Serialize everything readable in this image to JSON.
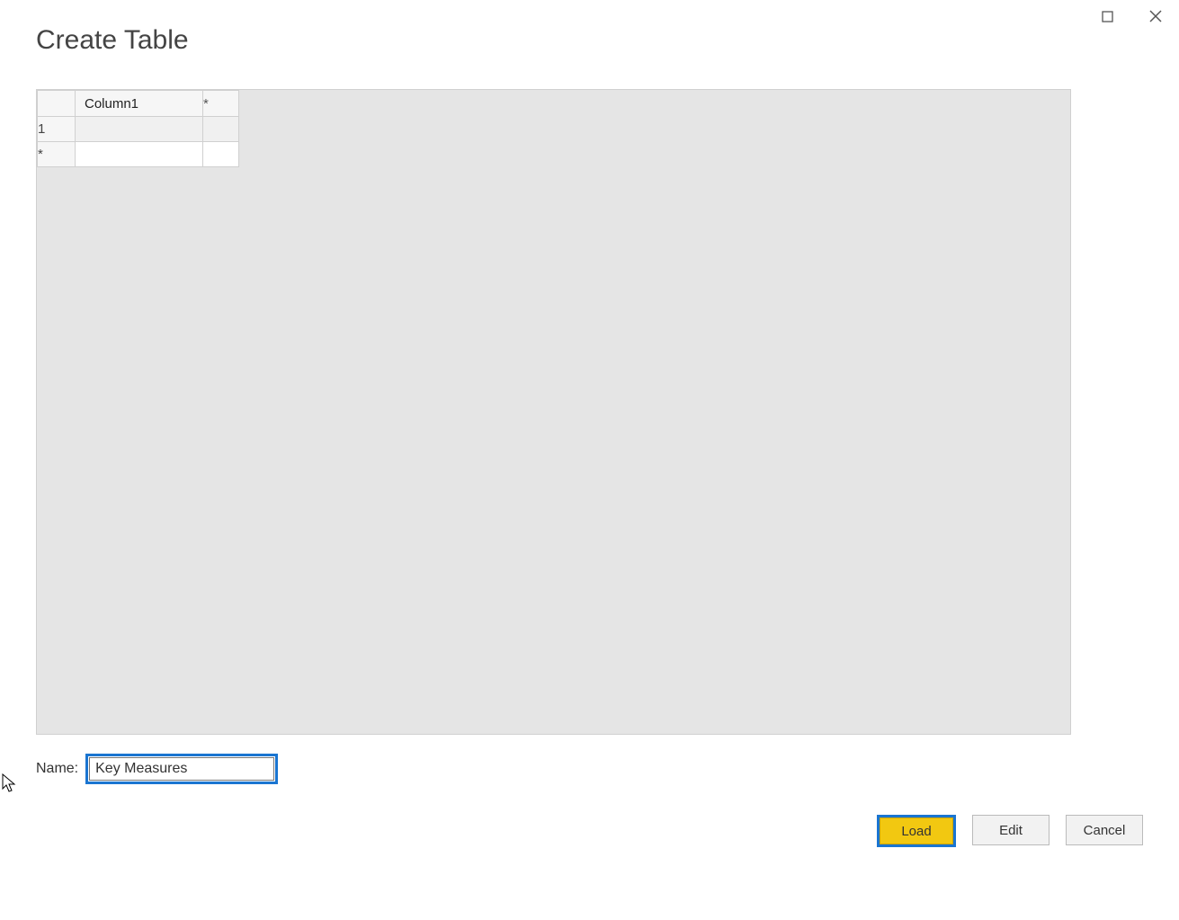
{
  "dialog": {
    "title": "Create Table"
  },
  "grid": {
    "column_header": "Column1",
    "add_column_marker": "*",
    "rows": [
      {
        "header": "1",
        "value": ""
      },
      {
        "header": "*",
        "value": ""
      }
    ]
  },
  "name_field": {
    "label": "Name:",
    "value": "Key Measures"
  },
  "buttons": {
    "load": "Load",
    "edit": "Edit",
    "cancel": "Cancel"
  }
}
